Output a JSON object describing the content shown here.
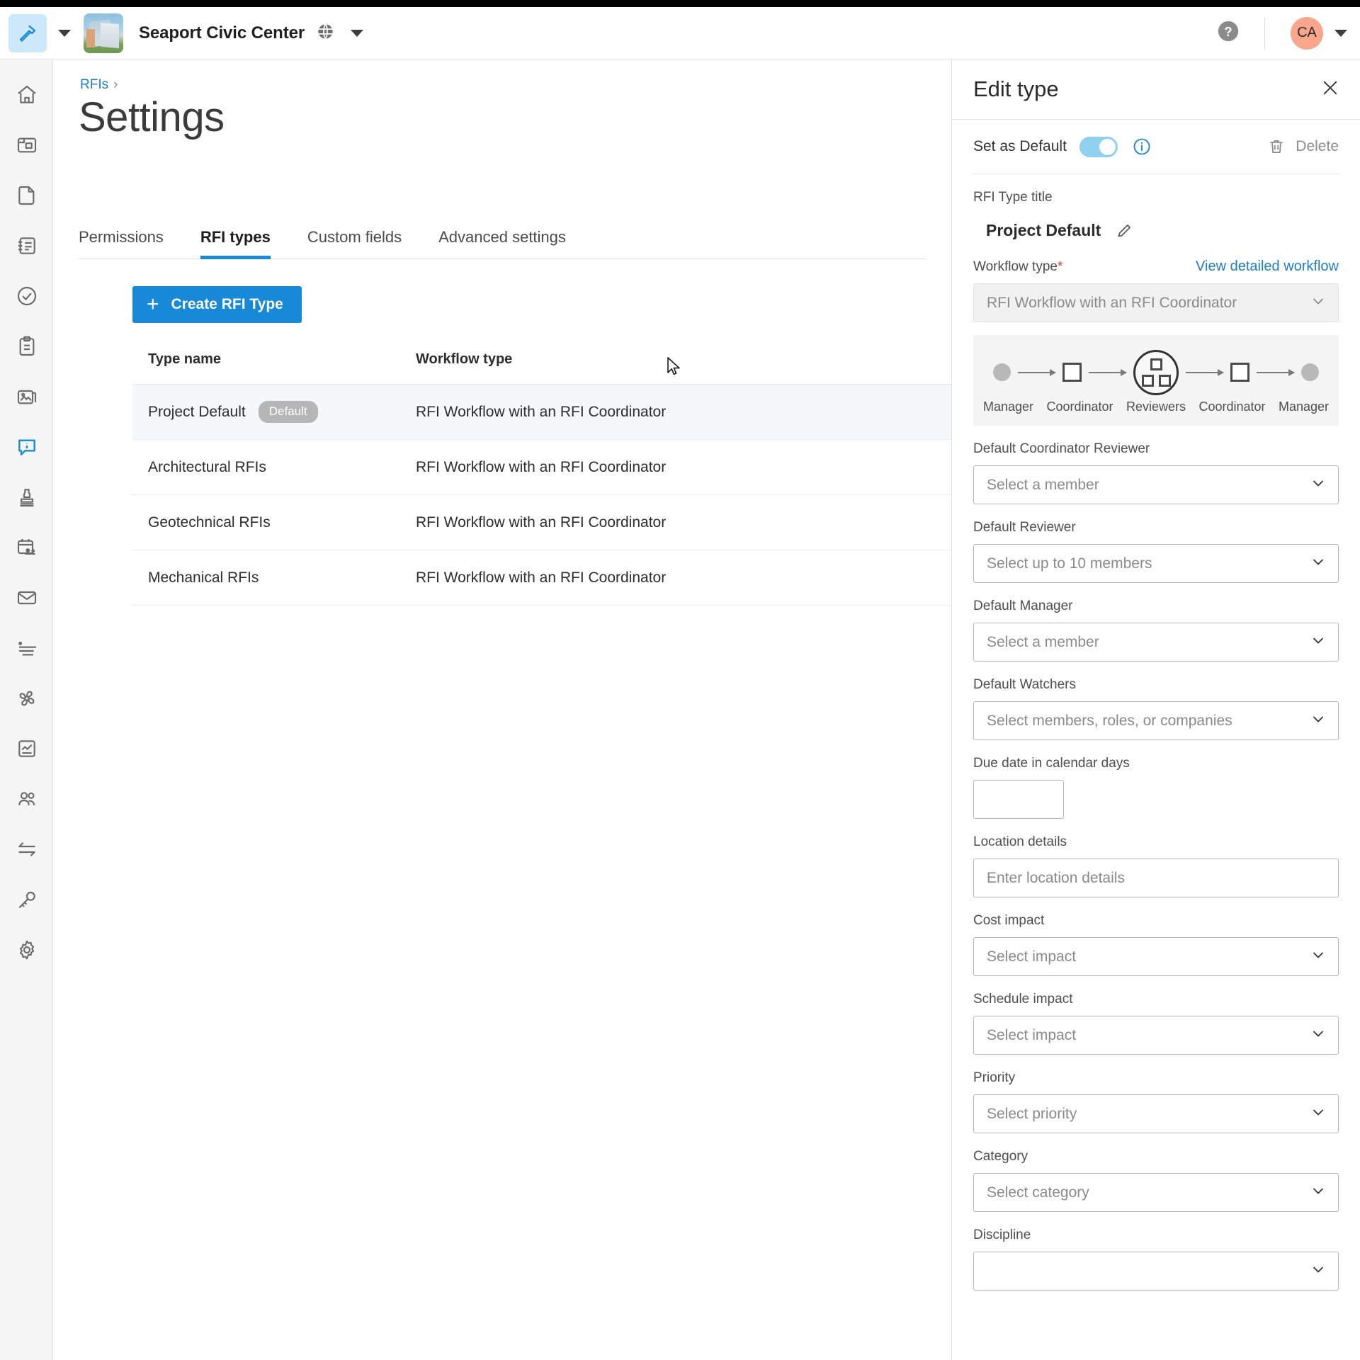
{
  "header": {
    "app_icon": "hammer-icon",
    "app_caret": "chevron-down-icon",
    "project_name": "Seaport Civic Center",
    "globe_icon": "globe-icon",
    "project_caret": "chevron-down-icon",
    "help_icon": "help-circle-icon",
    "avatar_initials": "CA",
    "avatar_caret": "chevron-down-icon"
  },
  "rail": {
    "items": [
      {
        "name": "home-icon",
        "active": false
      },
      {
        "name": "drawings-icon",
        "active": false
      },
      {
        "name": "document-icon",
        "active": false
      },
      {
        "name": "specifications-icon",
        "active": false
      },
      {
        "name": "check-circle-icon",
        "active": false
      },
      {
        "name": "clipboard-icon",
        "active": false
      },
      {
        "name": "photos-icon",
        "active": false
      },
      {
        "name": "rfi-info-icon",
        "active": true
      },
      {
        "name": "submittal-stamp-icon",
        "active": false
      },
      {
        "name": "meetings-calendar-icon",
        "active": false
      },
      {
        "name": "mail-icon",
        "active": false
      },
      {
        "name": "tasks-list-icon",
        "active": false
      },
      {
        "name": "fan-icon",
        "active": false
      },
      {
        "name": "reports-chart-icon",
        "active": false
      },
      {
        "name": "directory-people-icon",
        "active": false
      },
      {
        "name": "transfer-arrows-icon",
        "active": false
      },
      {
        "name": "key-icon",
        "active": false
      },
      {
        "name": "settings-gear-icon",
        "active": false
      }
    ]
  },
  "main": {
    "breadcrumb": {
      "root": "RFIs",
      "chevron": "›"
    },
    "page_title": "Settings",
    "tabs": [
      {
        "label": "Permissions",
        "active": false
      },
      {
        "label": "RFI types",
        "active": true
      },
      {
        "label": "Custom fields",
        "active": false
      },
      {
        "label": "Advanced settings",
        "active": false
      }
    ],
    "create_button": {
      "plus": "+",
      "label": "Create RFI Type"
    },
    "table": {
      "columns": [
        "Type name",
        "Workflow type"
      ],
      "rows": [
        {
          "name": "Project Default",
          "badge": "Default",
          "workflow": "RFI Workflow with an RFI Coordinator",
          "selected": true
        },
        {
          "name": "Architectural RFIs",
          "badge": "",
          "workflow": "RFI Workflow with an RFI Coordinator",
          "selected": false
        },
        {
          "name": "Geotechnical RFIs",
          "badge": "",
          "workflow": "RFI Workflow with an RFI Coordinator",
          "selected": false
        },
        {
          "name": "Mechanical RFIs",
          "badge": "",
          "workflow": "RFI Workflow with an RFI Coordinator",
          "selected": false
        }
      ]
    }
  },
  "panel": {
    "title": "Edit type",
    "close_icon": "close-icon",
    "set_default_label": "Set as Default",
    "set_default_on": true,
    "info_icon": "info-icon",
    "delete_label": "Delete",
    "trash_icon": "trash-icon",
    "rfi_type_title_label": "RFI Type title",
    "rfi_type_title_value": "Project Default",
    "edit_title_icon": "pencil-icon",
    "workflow_type_label": "Workflow type",
    "workflow_required_mark": "*",
    "view_workflow_link": "View detailed workflow",
    "workflow_value": "RFI Workflow with an RFI Coordinator",
    "workflow_diagram": {
      "steps": [
        {
          "label": "Manager",
          "shape": "dot"
        },
        {
          "label": "Coordinator",
          "shape": "square"
        },
        {
          "label": "Reviewers",
          "shape": "group-circle"
        },
        {
          "label": "Coordinator",
          "shape": "square"
        },
        {
          "label": "Manager",
          "shape": "dot"
        }
      ]
    },
    "fields": [
      {
        "label": "Default Coordinator Reviewer",
        "placeholder": "Select a member",
        "kind": "select"
      },
      {
        "label": "Default Reviewer",
        "placeholder": "Select up to 10 members",
        "kind": "select"
      },
      {
        "label": "Default Manager",
        "placeholder": "Select a member",
        "kind": "select"
      },
      {
        "label": "Default Watchers",
        "placeholder": "Select members, roles, or companies",
        "kind": "select"
      },
      {
        "label": "Due date in calendar days",
        "placeholder": "",
        "kind": "input-small"
      },
      {
        "label": "Location details",
        "placeholder": "Enter location details",
        "kind": "input"
      },
      {
        "label": "Cost impact",
        "placeholder": "Select impact",
        "kind": "select"
      },
      {
        "label": "Schedule impact",
        "placeholder": "Select impact",
        "kind": "select"
      },
      {
        "label": "Priority",
        "placeholder": "Select priority",
        "kind": "select"
      },
      {
        "label": "Category",
        "placeholder": "Select category",
        "kind": "select"
      },
      {
        "label": "Discipline",
        "placeholder": "",
        "kind": "select-cut"
      }
    ]
  },
  "colors": {
    "accent": "#1789d6",
    "link": "#1f7ec4",
    "toggle_on": "#8fd0ee",
    "badge_gray": "#b6b6b6",
    "avatar": "#f9a68d",
    "required_red": "#e03b3b"
  }
}
